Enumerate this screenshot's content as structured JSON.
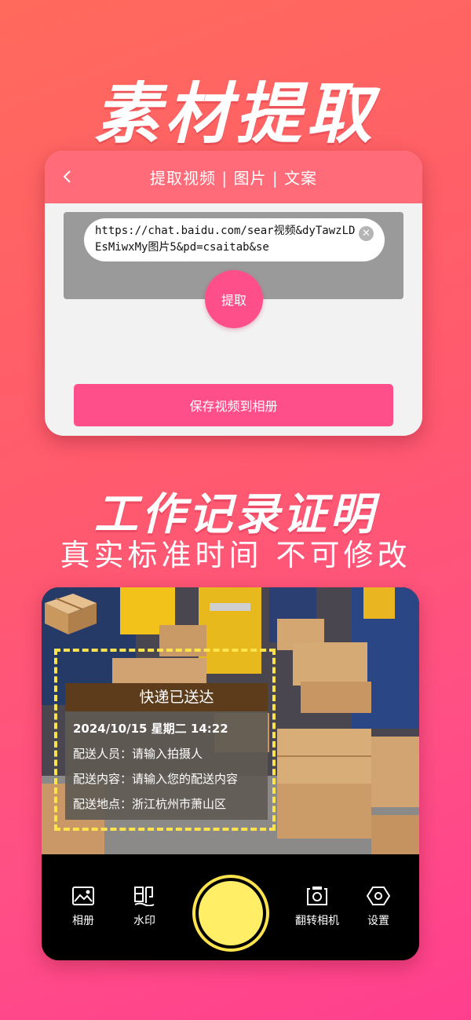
{
  "headline_top": "素材提取",
  "extractor": {
    "header_title": "提取视频 | 图片 | 文案",
    "url_value": "https://chat.baidu.com/sear视频&dyTawzLDEsMiwxMy图片5&pd=csaitab&se",
    "extract_label": "提取",
    "save_label": "保存视频到相册"
  },
  "headline_mid": "工作记录证明",
  "subtitle": "真实标准时间  不可修改",
  "watermark": {
    "title": "快递已送达",
    "datetime": "2024/10/15 星期二 14:22",
    "courier": "配送人员：请输入拍摄人",
    "content": "配送内容：请输入您的配送内容",
    "location": "配送地点：浙江杭州市萧山区"
  },
  "toolbar": {
    "album": "相册",
    "watermark": "水印",
    "flip": "翻转相机",
    "settings": "设置"
  },
  "colors": {
    "accent_pink": "#ff4f8b",
    "header_pink": "#ff6b78",
    "frame_yellow": "#ffe34d"
  }
}
